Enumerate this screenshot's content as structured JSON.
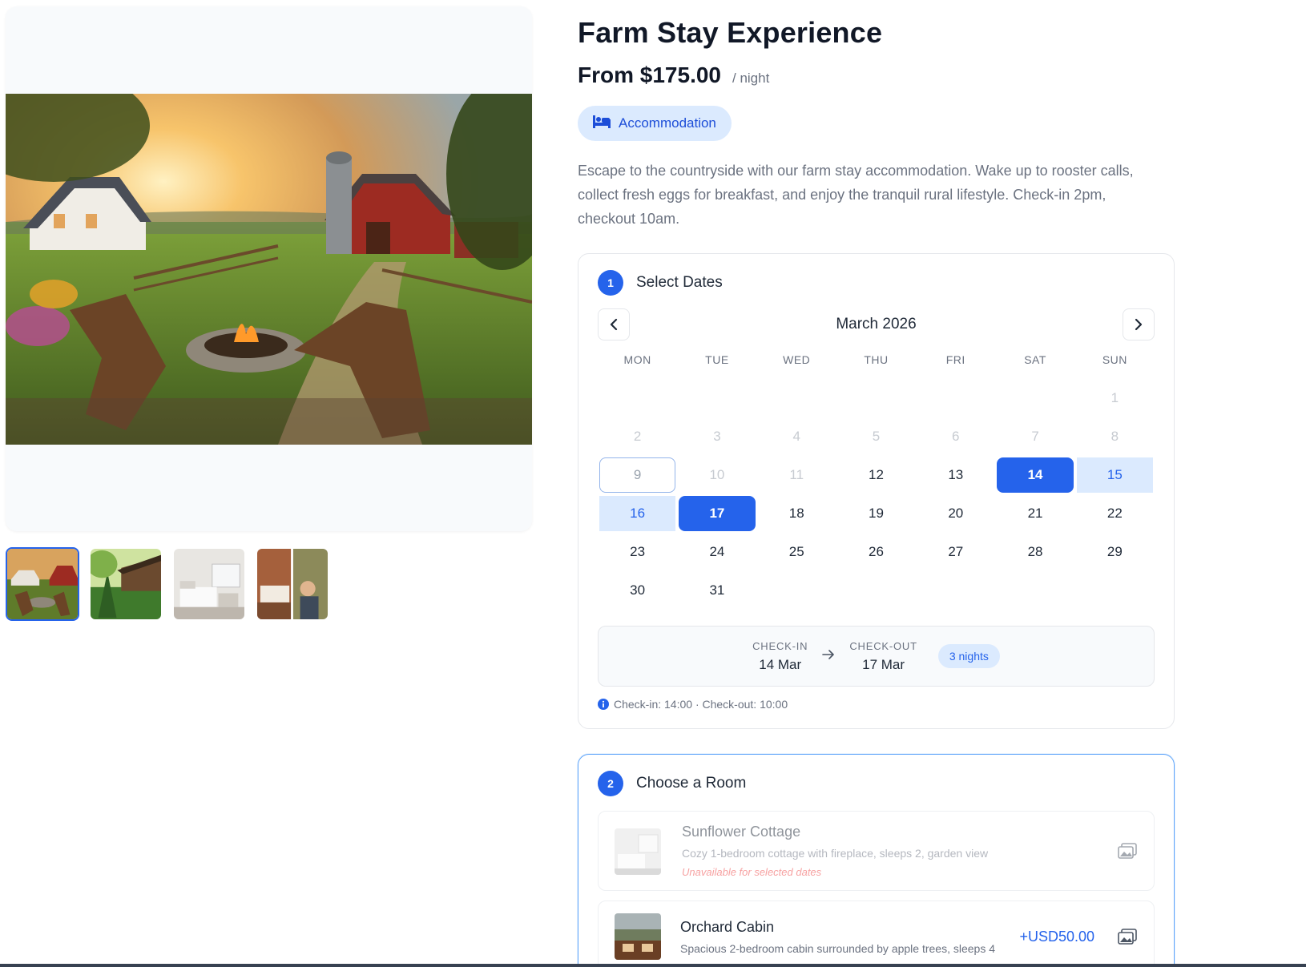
{
  "listing": {
    "title": "Farm Stay Experience",
    "price": "From $175.00",
    "per_unit": "/ night",
    "type_label": "Accommodation",
    "type_icon": "bed-icon",
    "description": "Escape to the countryside with our farm stay accommodation. Wake up to rooster calls, collect fresh eggs for breakfast, and enjoy the tranquil rural lifestyle. Check-in 2pm, checkout 10am."
  },
  "gallery": {
    "main_image": "farm-sunset-firepit-photo",
    "thumbnails": [
      {
        "name": "farm-firepit-thumb",
        "active": true
      },
      {
        "name": "forest-cabin-thumb",
        "active": false
      },
      {
        "name": "bedroom-thumb",
        "active": false
      },
      {
        "name": "farm-activities-thumb",
        "active": false
      }
    ]
  },
  "dates_step": {
    "number": "1",
    "title": "Select Dates",
    "month": "March 2026",
    "weekdays": [
      "MON",
      "TUE",
      "WED",
      "THU",
      "FRI",
      "SAT",
      "SUN"
    ],
    "leading_blanks": 6,
    "days_in_month": 31,
    "past_days": [
      1,
      2,
      3,
      4,
      5,
      6,
      7,
      8,
      10,
      11
    ],
    "today_day": 9,
    "check_in_day": 14,
    "check_out_day": 17,
    "summary": {
      "check_in_label": "CHECK-IN",
      "check_in_value": "14 Mar",
      "check_out_label": "CHECK-OUT",
      "check_out_value": "17 Mar",
      "nights": "3 nights"
    },
    "note": "Check-in: 14:00 · Check-out: 10:00"
  },
  "rooms_step": {
    "number": "2",
    "title": "Choose a Room",
    "rooms": [
      {
        "name": "Sunflower Cottage",
        "description": "Cozy 1-bedroom cottage with fireplace, sleeps 2, garden view",
        "status": "Unavailable for selected dates",
        "price": ""
      },
      {
        "name": "Orchard Cabin",
        "description": "Spacious 2-bedroom cabin surrounded by apple trees, sleeps 4",
        "status": "",
        "price": "+USD50.00"
      }
    ]
  },
  "colors": {
    "accent": "#2563eb",
    "accent_light": "#dbeafe",
    "text": "#1f2937",
    "muted": "#6b7280",
    "warning": "#ef4444"
  }
}
